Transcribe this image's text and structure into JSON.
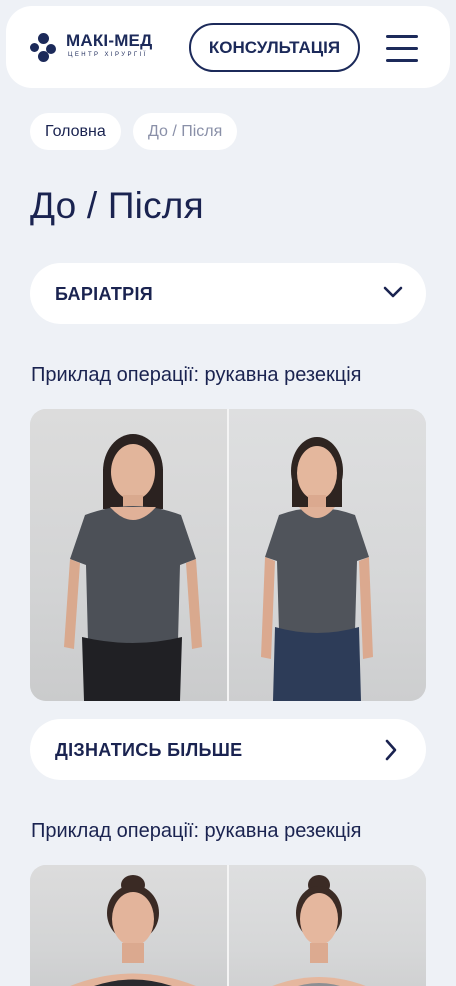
{
  "header": {
    "logo_name": "МАКІ-МЕД",
    "logo_sub": "ЦЕНТР ХІРУРГІЇ",
    "consult_label": "КОНСУЛЬТАЦІЯ",
    "menu_icon": "hamburger-icon"
  },
  "breadcrumb": {
    "home": "Головна",
    "current": "До / Після"
  },
  "page": {
    "title": "До / Після"
  },
  "filter": {
    "selected": "БАРІАТРІЯ",
    "icon": "chevron-down-icon"
  },
  "examples": [
    {
      "title": "Приклад операції: рукавна резекція",
      "more_label": "ДІЗНАТИСЬ БІЛЬШЕ",
      "more_icon": "chevron-right-icon"
    },
    {
      "title": "Приклад операції: рукавна резекція"
    }
  ],
  "colors": {
    "brand": "#1c2a5a",
    "background": "#eef1f6",
    "card": "#ffffff",
    "muted": "#8a90a8"
  }
}
